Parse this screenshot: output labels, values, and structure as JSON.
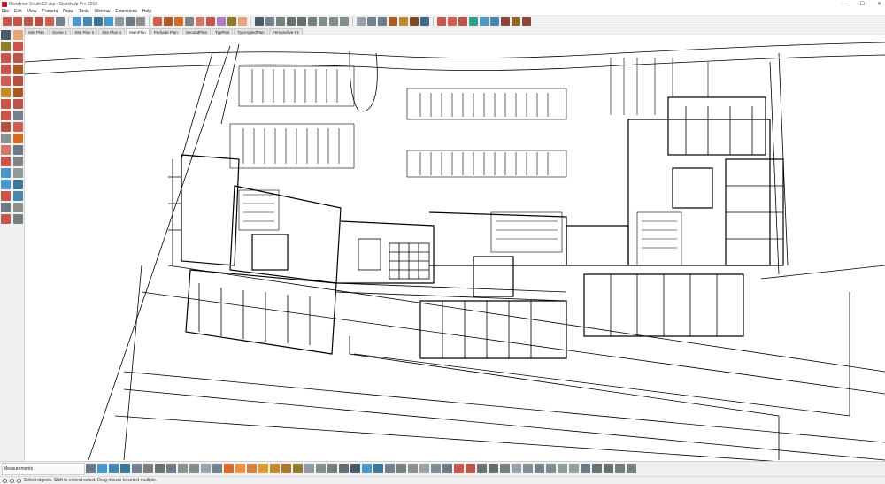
{
  "window": {
    "title": "Riverfront South 12.skp - SketchUp Pro 2018",
    "minimize": "—",
    "maximize": "☐",
    "close": "✕"
  },
  "menu": [
    "File",
    "Edit",
    "View",
    "Camera",
    "Draw",
    "Tools",
    "Window",
    "Extensions",
    "Help"
  ],
  "scenes": [
    {
      "label": "Site Plan",
      "active": false
    },
    {
      "label": "Scene 2",
      "active": false
    },
    {
      "label": "Site Plan 2",
      "active": false
    },
    {
      "label": "Site Plan 4",
      "active": false
    },
    {
      "label": "MainPlan",
      "active": true
    },
    {
      "label": "Parkade Plan",
      "active": false
    },
    {
      "label": "SecondPlan",
      "active": false
    },
    {
      "label": "TypPlan",
      "active": false
    },
    {
      "label": "TypAngledPlan",
      "active": false
    },
    {
      "label": "Perspective-01",
      "active": false
    }
  ],
  "top_toolbar": [
    {
      "name": "move-icon",
      "color": "#c0392b"
    },
    {
      "name": "rotate-icon",
      "color": "#c0392b"
    },
    {
      "name": "scale-icon",
      "color": "#b03a2e"
    },
    {
      "name": "push-pull-icon",
      "color": "#a93226"
    },
    {
      "name": "offset-icon",
      "color": "#cb4335"
    },
    {
      "name": "follow-me-icon",
      "color": "#5d6d7e"
    },
    {
      "name": "zoom-icon",
      "color": "#2e86c1"
    },
    {
      "name": "zoom-window-icon",
      "color": "#2874a6"
    },
    {
      "name": "zoom-extents-icon",
      "color": "#1f618d"
    },
    {
      "name": "orbit-icon",
      "color": "#2e86c1"
    },
    {
      "name": "pan-icon",
      "color": "#7f8c8d"
    },
    {
      "name": "walk-icon",
      "color": "#566573"
    },
    {
      "name": "look-around-icon",
      "color": "#7b7d7d"
    },
    {
      "name": "section-plane-icon",
      "color": "#cb4335"
    },
    {
      "name": "section-display-icon",
      "color": "#a04000"
    },
    {
      "name": "dimension-icon",
      "color": "#d35400"
    },
    {
      "name": "text-icon",
      "color": "#6e6e6e"
    },
    {
      "name": "protractor-icon",
      "color": "#cd6155"
    },
    {
      "name": "axes-icon",
      "color": "#c0392b"
    },
    {
      "name": "tape-icon",
      "color": "#a569bd"
    },
    {
      "name": "paint-icon",
      "color": "#7d6608"
    },
    {
      "name": "eraser-icon",
      "color": "#e59866"
    },
    {
      "name": "select-icon",
      "color": "#2e4053"
    },
    {
      "name": "component-icon",
      "color": "#5d6d7e"
    },
    {
      "name": "group-icon",
      "color": "#616a6b"
    },
    {
      "name": "iso-view-icon",
      "color": "#515a5a"
    },
    {
      "name": "top-view-icon",
      "color": "#4d5656"
    },
    {
      "name": "front-view-icon",
      "color": "#5f6a6a"
    },
    {
      "name": "right-view-icon",
      "color": "#6c7a7b"
    },
    {
      "name": "back-view-icon",
      "color": "#6c7a7b"
    },
    {
      "name": "left-view-icon",
      "color": "#6c7a7b"
    },
    {
      "name": "xray-icon",
      "color": "#85929e"
    },
    {
      "name": "wireframe-icon",
      "color": "#5d6d7e"
    },
    {
      "name": "hidden-line-icon",
      "color": "#566573"
    },
    {
      "name": "shaded-icon",
      "color": "#a04000"
    },
    {
      "name": "textured-icon",
      "color": "#b9770e"
    },
    {
      "name": "monochrome-icon",
      "color": "#6e2c00"
    },
    {
      "name": "cursor-icon",
      "color": "#1a5276"
    },
    {
      "name": "warehouse-icon",
      "color": "#c0392b"
    },
    {
      "name": "extension-warehouse-icon",
      "color": "#cb4335"
    },
    {
      "name": "layout-icon",
      "color": "#b03a2e"
    },
    {
      "name": "geo-icon",
      "color": "#138d75"
    },
    {
      "name": "upload-icon",
      "color": "#2e86c1"
    },
    {
      "name": "download-icon",
      "color": "#2874a6"
    },
    {
      "name": "sandbox-icon",
      "color": "#7b241c"
    },
    {
      "name": "photo-match-icon",
      "color": "#7e5109"
    },
    {
      "name": "solid-tools-icon",
      "color": "#78281f"
    }
  ],
  "left_toolbar": [
    {
      "name": "select-tool-icon",
      "color": "#2e4053"
    },
    {
      "name": "eraser-tool-icon",
      "color": "#e59866"
    },
    {
      "name": "paint-bucket-icon",
      "color": "#7d6608"
    },
    {
      "name": "freehand-icon",
      "color": "#c0392b"
    },
    {
      "name": "line-tool-icon",
      "color": "#c0392b"
    },
    {
      "name": "arc-tool-icon",
      "color": "#b03a2e"
    },
    {
      "name": "rectangle-tool-icon",
      "color": "#c0392b"
    },
    {
      "name": "circle-tool-icon",
      "color": "#a04000"
    },
    {
      "name": "polygon-tool-icon",
      "color": "#cb4335"
    },
    {
      "name": "rotated-rect-icon",
      "color": "#a93226"
    },
    {
      "name": "pie-icon",
      "color": "#b9770e"
    },
    {
      "name": "three-point-arc-icon",
      "color": "#a04000"
    },
    {
      "name": "move-tool-icon",
      "color": "#c0392b"
    },
    {
      "name": "push-pull-tool-icon",
      "color": "#b03a2e"
    },
    {
      "name": "rotate-tool-icon",
      "color": "#c0392b"
    },
    {
      "name": "follow-me-tool-icon",
      "color": "#5d6d7e"
    },
    {
      "name": "scale-tool-icon",
      "color": "#a93226"
    },
    {
      "name": "offset-tool-icon",
      "color": "#cb4335"
    },
    {
      "name": "tape-tool-icon",
      "color": "#7b7d7d"
    },
    {
      "name": "dimension-tool-icon",
      "color": "#d35400"
    },
    {
      "name": "protractor-tool-icon",
      "color": "#cd6155"
    },
    {
      "name": "text-tool-icon",
      "color": "#566573"
    },
    {
      "name": "axes-tool-icon",
      "color": "#c0392b"
    },
    {
      "name": "3d-text-icon",
      "color": "#6e6e6e"
    },
    {
      "name": "orbit-tool-icon",
      "color": "#2e86c1"
    },
    {
      "name": "pan-tool-icon",
      "color": "#7f8c8d"
    },
    {
      "name": "zoom-tool-icon",
      "color": "#2e86c1"
    },
    {
      "name": "zoom-window-tool-icon",
      "color": "#1f618d"
    },
    {
      "name": "zoom-extents-tool-icon",
      "color": "#c0392b"
    },
    {
      "name": "previous-view-icon",
      "color": "#2874a6"
    },
    {
      "name": "walk-tool-icon",
      "color": "#566573"
    },
    {
      "name": "look-around-tool-icon",
      "color": "#7b7d7d"
    },
    {
      "name": "section-tool-icon",
      "color": "#c0392b"
    },
    {
      "name": "position-camera-icon",
      "color": "#616a6b"
    }
  ],
  "bottom_toolbar": [
    {
      "name": "axis-tool-icon",
      "color": "#566573"
    },
    {
      "name": "sandbox-from-contours-icon",
      "color": "#2e86c1"
    },
    {
      "name": "sandbox-from-scratch-icon",
      "color": "#2874a6"
    },
    {
      "name": "smoove-icon",
      "color": "#1f618d"
    },
    {
      "name": "stamp-icon",
      "color": "#5d6d7e"
    },
    {
      "name": "drape-icon",
      "color": "#616a6b"
    },
    {
      "name": "add-detail-icon",
      "color": "#515a5a"
    },
    {
      "name": "flip-edge-icon",
      "color": "#566573"
    },
    {
      "name": "dynamic-component-icon",
      "color": "#7b7d7d"
    },
    {
      "name": "interact-icon",
      "color": "#6c7a7b"
    },
    {
      "name": "component-options-icon",
      "color": "#85929e"
    },
    {
      "name": "component-attributes-icon",
      "color": "#5d6d7e"
    },
    {
      "name": "solid-outer-shell-icon",
      "color": "#d35400"
    },
    {
      "name": "solid-intersect-icon",
      "color": "#e67e22"
    },
    {
      "name": "solid-union-icon",
      "color": "#ca6f1e"
    },
    {
      "name": "solid-subtract-icon",
      "color": "#d68910"
    },
    {
      "name": "solid-trim-icon",
      "color": "#b9770e"
    },
    {
      "name": "solid-split-icon",
      "color": "#9c640c"
    },
    {
      "name": "shadow-icon",
      "color": "#7d6608"
    },
    {
      "name": "fog-icon",
      "color": "#808b96"
    },
    {
      "name": "style-icon",
      "color": "#707b7c"
    },
    {
      "name": "layer-icon",
      "color": "#5f6a6a"
    },
    {
      "name": "outliner-icon",
      "color": "#4d5656"
    },
    {
      "name": "scene-icon",
      "color": "#2e4053"
    },
    {
      "name": "entity-info-icon",
      "color": "#2e86c1"
    },
    {
      "name": "materials-icon",
      "color": "#1f618d"
    },
    {
      "name": "components-panel-icon",
      "color": "#5d6d7e"
    },
    {
      "name": "instructor-icon",
      "color": "#616a6b"
    },
    {
      "name": "soften-edges-icon",
      "color": "#7b7d7d"
    },
    {
      "name": "match-photo-icon",
      "color": "#85929e"
    },
    {
      "name": "model-info-icon",
      "color": "#6c7a7b"
    },
    {
      "name": "preferences-icon",
      "color": "#566573"
    },
    {
      "name": "ruby-console-icon",
      "color": "#c0392b"
    },
    {
      "name": "extension-manager-icon",
      "color": "#b03a2e"
    },
    {
      "name": "export-icon",
      "color": "#515a5a"
    },
    {
      "name": "print-icon",
      "color": "#4d5656"
    },
    {
      "name": "camera-icon",
      "color": "#616a6b"
    },
    {
      "name": "section-fill-icon",
      "color": "#85929e"
    },
    {
      "name": "visibility-icon",
      "color": "#707b7c"
    },
    {
      "name": "lock-icon",
      "color": "#5d6d7e"
    },
    {
      "name": "unlock-icon",
      "color": "#6c7a7b"
    },
    {
      "name": "hide-icon",
      "color": "#7f8c8d"
    },
    {
      "name": "unhide-icon",
      "color": "#839192"
    },
    {
      "name": "ungroup-icon",
      "color": "#566573"
    },
    {
      "name": "explode-icon",
      "color": "#515a5a"
    },
    {
      "name": "make-component-icon",
      "color": "#4d5656"
    },
    {
      "name": "reverse-faces-icon",
      "color": "#5f6a6a"
    },
    {
      "name": "orient-faces-icon",
      "color": "#616a6b"
    }
  ],
  "measurements": {
    "label": "Measurements"
  },
  "status": {
    "text": "Select objects. Shift to extend select. Drag mouse to select multiple."
  }
}
